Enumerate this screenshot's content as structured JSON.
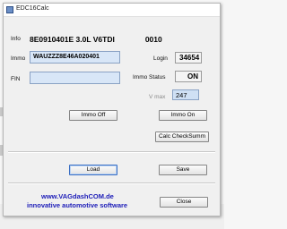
{
  "window": {
    "title": "EDC16Calc"
  },
  "fields": {
    "info_label": "Info",
    "info_part": "8E0910401E  3.0L V6TDI",
    "info_code": "0010",
    "immo_label": "Immo",
    "immo_value": "WAUZZZ8E46A020401",
    "fin_label": "FIN",
    "fin_value": "",
    "login_label": "Login",
    "login_value": "34654",
    "immo_status_label": "Immo Status",
    "immo_status_value": "ON",
    "vmax_label": "V max",
    "vmax_value": "247"
  },
  "buttons": {
    "immo_off": "Immo Off",
    "immo_on": "Immo On",
    "calc_checksum": "Calc CheckSumm",
    "load": "Load",
    "save": "Save",
    "close": "Close"
  },
  "footer": {
    "line1": "www.VAGdashCOM.de",
    "line2": "innovative automotive software"
  }
}
